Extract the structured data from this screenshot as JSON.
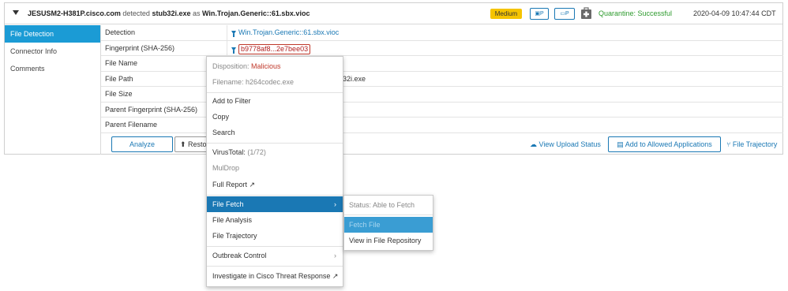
{
  "header": {
    "host": "JESUSM2-H381P.cisco.com",
    "detected_word": " detected ",
    "file": "stub32i.exe",
    "as_word": " as ",
    "threat": "Win.Trojan.Generic::61.sbx.vioc",
    "severity": "Medium",
    "severity_color": "#f5c400",
    "icon1_text": "▣P",
    "icon2_text": "▭P",
    "quarantine": "Quarantine: Successful",
    "quarantine_color": "#2d9a2d",
    "date": "2020-04-09 10:47:44 CDT"
  },
  "sidebar": {
    "items": [
      {
        "label": "File Detection",
        "active": true
      },
      {
        "label": "Connector Info",
        "active": false
      },
      {
        "label": "Comments",
        "active": false
      }
    ]
  },
  "rows": [
    {
      "label": "Detection",
      "value": "Win.Trojan.Generic::61.sbx.vioc"
    },
    {
      "label": "Fingerprint (SHA-256)",
      "value": "b9778af8...2e7bee03"
    },
    {
      "label": "File Name",
      "value": ""
    },
    {
      "label": "File Path",
      "value": "32i.exe"
    },
    {
      "label": "File Size",
      "value": ""
    },
    {
      "label": "Parent Fingerprint (SHA-256)",
      "value": ""
    },
    {
      "label": "Parent Filename",
      "value": ""
    }
  ],
  "actions": {
    "analyze": "Analyze",
    "restore": "Restor",
    "view_upload": "View Upload Status",
    "allowed": "Add to Allowed Applications",
    "trajectory": "File Trajectory"
  },
  "context_menu": {
    "disposition_label": "Disposition: ",
    "disposition_value": "Malicious",
    "filename": "Filename: h264codec.exe",
    "add_filter": "Add to Filter",
    "copy": "Copy",
    "search": "Search",
    "virustotal_label": "VirusTotal: ",
    "virustotal_value": "(1/72)",
    "muldrop": "MulDrop",
    "full_report": "Full Report",
    "file_fetch": "File Fetch",
    "file_analysis": "File Analysis",
    "file_trajectory": "File Trajectory",
    "outbreak_control": "Outbreak Control",
    "investigate": "Investigate in Cisco Threat Response"
  },
  "submenu": {
    "status": "Status: Able to Fetch",
    "fetch_file": "Fetch File",
    "view_repo": "View in File Repository"
  },
  "colors": {
    "accent": "#1a78b4",
    "nav_active": "#1b9bd5",
    "malicious": "#c0392b"
  }
}
